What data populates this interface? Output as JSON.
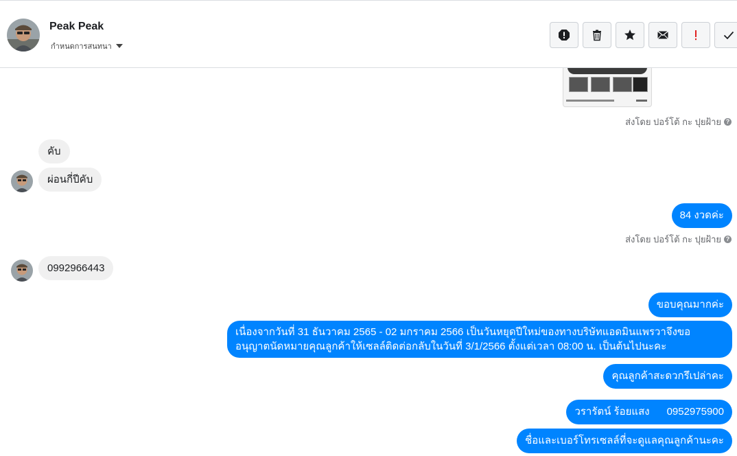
{
  "contact": {
    "name": "Peak Peak",
    "assign_label": "กำหนดการสนทนา"
  },
  "toolbar": {
    "icons": [
      "spam-icon",
      "trash-icon",
      "star-icon",
      "envelope-icon",
      "exclamation-icon",
      "check-icon"
    ],
    "colors": {
      "exclamation": "#e02020",
      "default": "#1c1e21"
    }
  },
  "colors": {
    "outgoing_bubble": "#0084ff",
    "incoming_bubble": "#f0f0f0"
  },
  "messages": {
    "sent_by_1": "ส่งโดย ปอร์โต้ กะ ปุยฝ้าย",
    "in_1": "คับ",
    "in_2": "ผ่อนกี่ปีคับ",
    "out_1": "84 งวดค่ะ",
    "sent_by_2": "ส่งโดย ปอร์โต้ กะ ปุยฝ้าย",
    "in_3": "0992966443",
    "out_2": "ขอบคุณมากค่ะ",
    "out_3": "เนื่องจากวันที่ 31 ธันวาคม 2565 - 02 มกราคม 2566 เป็นวันหยุดปีใหม่ของทางบริษัทแอดมินแพรวาจึงขออนุญาตนัดหมายคุณลูกค้าให้เซลล์ติดต่อกลับในวันที่  3/1/2566  ตั้งแต่เวลา 08:00 น. เป็นต้นไปนะคะ",
    "out_4": "คุณลูกค้าสะดวกรึเปล่าคะ",
    "out_5": "วรารัตน์ ร้อยแสง      0952975900",
    "out_6": "ชื่อและเบอร์โทรเซลล์ที่จะดูแลคุณลูกค้านะคะ"
  }
}
